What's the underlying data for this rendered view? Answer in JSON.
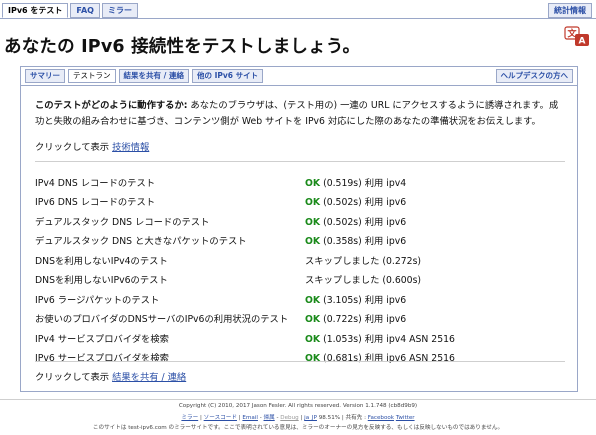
{
  "top_tabs": [
    {
      "label": "IPv6 をテスト",
      "active": true
    },
    {
      "label": "FAQ",
      "active": false
    },
    {
      "label": "ミラー",
      "active": false
    }
  ],
  "top_right_tab": "統計情報",
  "page_title": "あなたの IPv6 接続性をテストしましょう。",
  "panel_tabs": {
    "summary": "サマリー",
    "tests": "テストラン",
    "share": "結果を共有 / 連絡",
    "other": "他の IPv6 サイト",
    "help": "ヘルプデスクの方へ"
  },
  "intro": {
    "bold": "このテストがどのように動作するか:",
    "text": " あなたのブラウザは、(テスト用の) 一連の URL にアクセスするように誘導されます。成功と失敗の組み合わせに基づき、コンテンツ側が Web サイトを IPv6 対応にした際のあなたの準備状況をお伝えします。"
  },
  "show_tech": {
    "prefix": "クリックして表示 ",
    "link": "技術情報"
  },
  "results": [
    {
      "test": "IPv4 DNS レコードのテスト",
      "ok": "OK",
      "detail": " (0.519s) 利用 ipv4"
    },
    {
      "test": "IPv6 DNS レコードのテスト",
      "ok": "OK",
      "detail": " (0.502s) 利用 ipv6"
    },
    {
      "test": "デュアルスタック DNS レコードのテスト",
      "ok": "OK",
      "detail": " (0.502s) 利用 ipv6"
    },
    {
      "test": "デュアルスタック DNS と大きなパケットのテスト",
      "ok": "OK",
      "detail": " (0.358s) 利用 ipv6"
    },
    {
      "test": "DNSを利用しないIPv4のテスト",
      "ok": "",
      "detail": "スキップしました (0.272s)"
    },
    {
      "test": "DNSを利用しないIPv6のテスト",
      "ok": "",
      "detail": "スキップしました (0.600s)"
    },
    {
      "test": "IPv6 ラージパケットのテスト",
      "ok": "OK",
      "detail": " (3.105s) 利用 ipv6"
    },
    {
      "test": "お使いのプロバイダのDNSサーバのIPv6の利用状況のテスト",
      "ok": "OK",
      "detail": " (0.722s) 利用 ipv6"
    },
    {
      "test": "IPv4 サービスプロバイダを検索",
      "ok": "OK",
      "detail": " (1.053s) 利用 ipv4 ASN 2516"
    },
    {
      "test": "IPv6 サービスプロバイダを検索",
      "ok": "OK",
      "detail": " (0.681s) 利用 ipv6 ASN 2516"
    }
  ],
  "show_share": {
    "prefix": "クリックして表示 ",
    "link": "結果を共有 / 連絡"
  },
  "footer": {
    "copyright": "Copyright (C) 2010, 2017 Jason Fesler. All rights reserved. Version 1.1.748 (cb8d9b9)",
    "links": {
      "mirrors": "ミラー",
      "source": "ソースコード",
      "email": "Email",
      "attrib": "帰属",
      "debug": "Debug",
      "lang": "ja_JP",
      "pct": " 98.51%",
      "share_prefix": " | 共有先 : ",
      "facebook": "Facebook",
      "twitter": "Twitter"
    },
    "note": "このサイトは test-ipv6.com のミラーサイトです。ここで表明されている意見は、ミラーのオーナーの見方を反映する、もしくは反映しないものではありません。"
  },
  "colors": {
    "tab_border": "#9aa7c8",
    "tab_bg": "#e8ecf7",
    "link": "#2b4fa6",
    "ok": "#1a8a1a"
  },
  "icons": {
    "translate": "translate-icon"
  }
}
